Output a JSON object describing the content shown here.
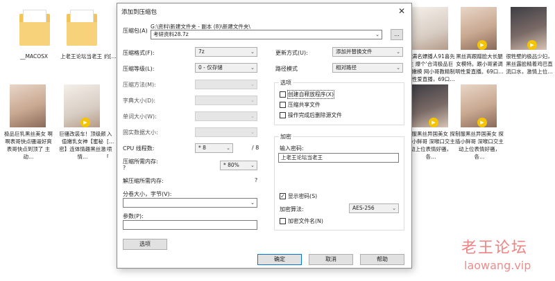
{
  "explorer": {
    "tiles": [
      {
        "caption": "__MACOSX"
      },
      {
        "caption": "上老王论坛当老王"
      },
      {
        "caption": "约[…"
      },
      {
        "caption": "露满名嫖播人91喜先生 爆个'合湾极品巨乳嫩模 网小哥教精制明性爱直播，69口…"
      },
      {
        "caption": "黑丝高跟蹭脸大长腿女模特。跟小哥紧调明性爱直播。69口…"
      },
      {
        "caption": "很牲壁的极品少妇，黑丝露脸精着鸡巴直流口水，激情上位…"
      },
      {
        "caption": "极品巨乳黑丝美女 啊啊表哥快点骚逼好爽 表哥快点到顶了 主动…"
      },
      {
        "caption": "巨骚改装车！顶级颜值嫩乳女神【蜜秘密】连体情趣黑丝激情…"
      },
      {
        "caption": "入[… 喷[…"
      },
      {
        "caption": "制服黑丝异国美女 探插小鲜哥 深喉口交主动上位表情好骚，各…"
      },
      {
        "caption": "制服黑丝异国美女 探插小鲜哥 深喉口交主动上位表情好骚，各…"
      }
    ],
    "play_icon": "play-icon",
    "watermark_cn": "老王论坛",
    "watermark_url": "laowang.vip"
  },
  "dialog": {
    "title": "添加到压缩包",
    "archive_label": "压缩包(A)",
    "archive_path": "G:\\资料\\新建文件夹 - 副本 (8)\\新建文件夹\\",
    "archive_name": "考研资料28.7z",
    "browse_label": "...",
    "format_label": "压缩格式(F):",
    "format_value": "7z",
    "level_label": "压缩等级(L):",
    "level_value": "0 - 仅存储",
    "method_label": "压缩方法(M):",
    "dict_label": "字典大小(D):",
    "word_label": "单词大小(W):",
    "solid_label": "固实数据大小:",
    "threads_label": "CPU 线程数:",
    "threads_value": "* 8",
    "threads_total": "/ 8",
    "mem_label": "压缩所需内存:",
    "mem_q": "?",
    "mem_value": "* 80%",
    "decomp_label": "解压缩所需内存:",
    "decomp_q": "?",
    "split_label": "分卷大小，字节(V):",
    "params_label": "参数(P):",
    "options_button": "选项",
    "update_label": "更新方式(U):",
    "update_value": "添加并替换文件",
    "path_label": "路径模式",
    "path_value": "相对路径",
    "options_group": "选项",
    "opt_sfx": "创建自释放程序(X)",
    "opt_shared": "压缩共享文件",
    "opt_delete": "操作完成后删除源文件",
    "encrypt_group": "加密",
    "password_label": "输入密码:",
    "password_value": "上老王论坛当老王",
    "show_password": "显示密码(S)",
    "enc_method_label": "加密算法:",
    "enc_method_value": "AES-256",
    "enc_names": "加密文件名(N)",
    "ok": "确定",
    "cancel": "取消",
    "help": "帮助",
    "close_icon": "close-icon"
  }
}
